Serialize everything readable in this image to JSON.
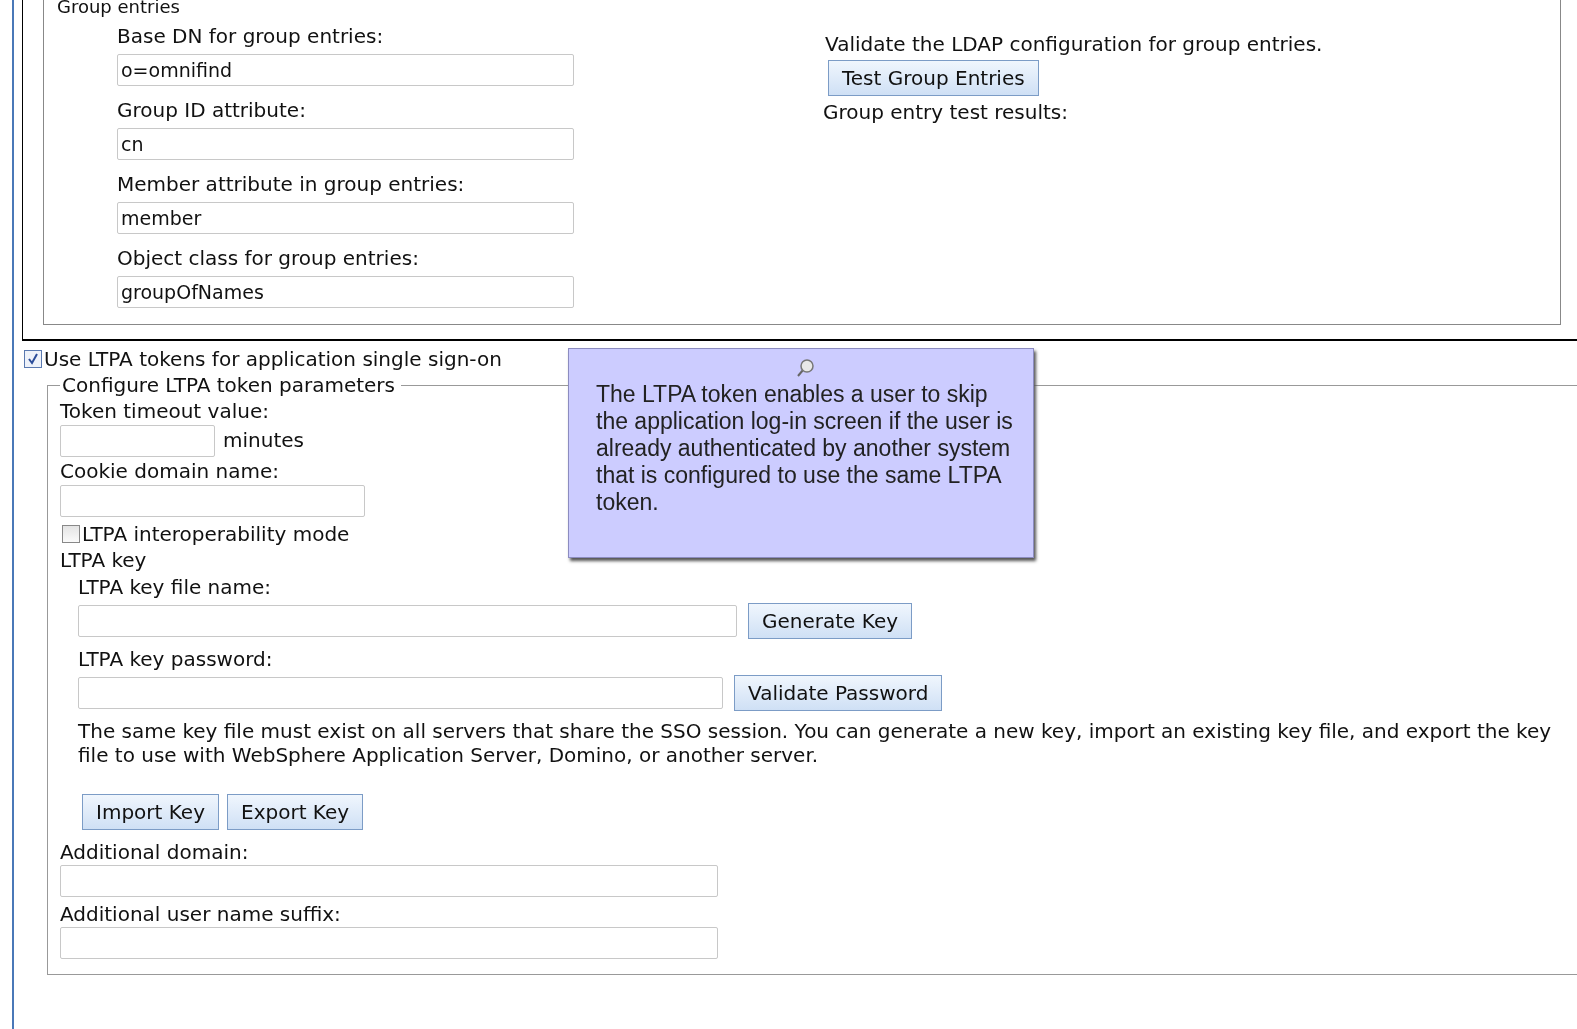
{
  "group_entries": {
    "legend": "Group entries",
    "fields": [
      {
        "label": "Base DN for group entries:",
        "value": "o=omnifind"
      },
      {
        "label": "Group ID attribute:",
        "value": "cn"
      },
      {
        "label": "Member attribute in group entries:",
        "value": "member"
      },
      {
        "label": "Object class for group entries:",
        "value": "groupOfNames"
      }
    ],
    "validate_text": "Validate the LDAP configuration for group entries.",
    "test_button": "Test Group Entries",
    "results_label": "Group entry test results:"
  },
  "ltpa": {
    "enable": {
      "label": "Use LTPA tokens for application single sign-on",
      "checked": true
    },
    "legend": "Configure LTPA token parameters",
    "timeout": {
      "label": "Token timeout value:",
      "unit": "minutes"
    },
    "cookie_domain": {
      "label": "Cookie domain name:"
    },
    "interop": {
      "label": "LTPA interoperability mode",
      "checked": false
    },
    "key_heading": "LTPA key",
    "key_file": {
      "label": "LTPA key file name:",
      "button": "Generate Key"
    },
    "key_password": {
      "label": "LTPA key password:",
      "button": "Validate Password"
    },
    "note": "The same key file must exist on all servers that share the SSO session. You can generate a new key, import an existing key file, and export the key file to use with WebSphere Application Server, Domino, or another server.",
    "buttons": [
      "Import Key",
      "Export Key"
    ],
    "additional_domain": {
      "label": "Additional domain:"
    },
    "user_suffix": {
      "label": "Additional user name suffix:"
    }
  },
  "tooltip": {
    "text": "The LTPA token enables a user to skip the application log-in screen if the user is already authenticated by another system that is configured to use the same LTPA token."
  }
}
